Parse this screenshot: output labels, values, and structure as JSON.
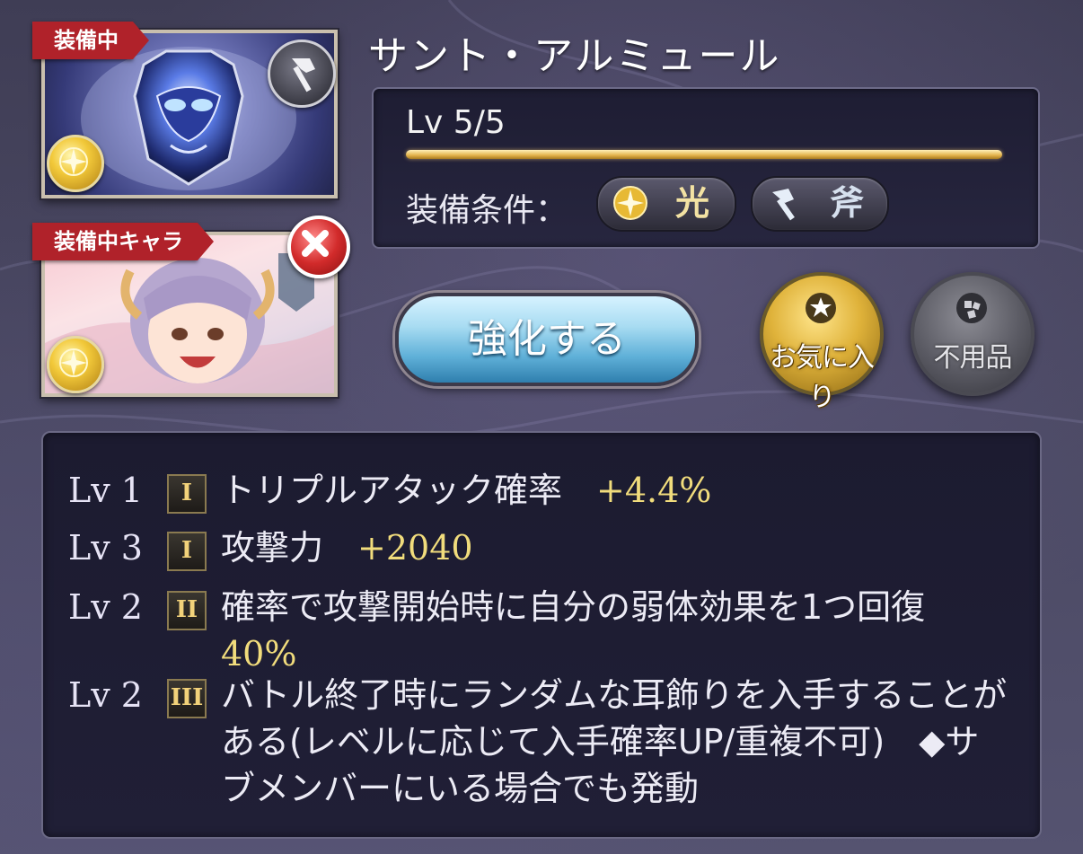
{
  "item": {
    "name": "サント・アルミュール",
    "equipped_badge": "装備中",
    "equipped_chara_badge": "装備中キャラ",
    "element_icon": "light-element-icon",
    "weapon_type_icon": "axe-icon"
  },
  "info": {
    "level_text": "Lv 5/5",
    "level_progress": 1.0,
    "conditions_label": "装備条件：",
    "conditions": [
      {
        "icon": "light-element-icon",
        "label": "光"
      },
      {
        "icon": "axe-icon",
        "label": "斧"
      }
    ]
  },
  "actions": {
    "enhance_label": "強化する",
    "favorite_label": "お気に入り",
    "unused_label": "不用品"
  },
  "skills": [
    {
      "lv": "Lv 1",
      "tier": "I",
      "text": "トリプルアタック確率",
      "value": "+4.4%"
    },
    {
      "lv": "Lv 3",
      "tier": "I",
      "text": "攻撃力",
      "value": "+2040"
    },
    {
      "lv": "Lv 2",
      "tier": "II",
      "text": "確率で攻撃開始時に自分の弱体効果を1つ回復",
      "value": "40%"
    },
    {
      "lv": "Lv 2",
      "tier": "III",
      "text": "バトル終了時にランダムな耳飾りを入手することがある(レベルに応じて入手確率UP/重複不可)　◆サブメンバーにいる場合でも発動",
      "value": ""
    }
  ],
  "colors": {
    "ribbon": "#b0222a",
    "accent_gold": "#f1dc7c",
    "enhance_blue": "#5fb0d8"
  }
}
